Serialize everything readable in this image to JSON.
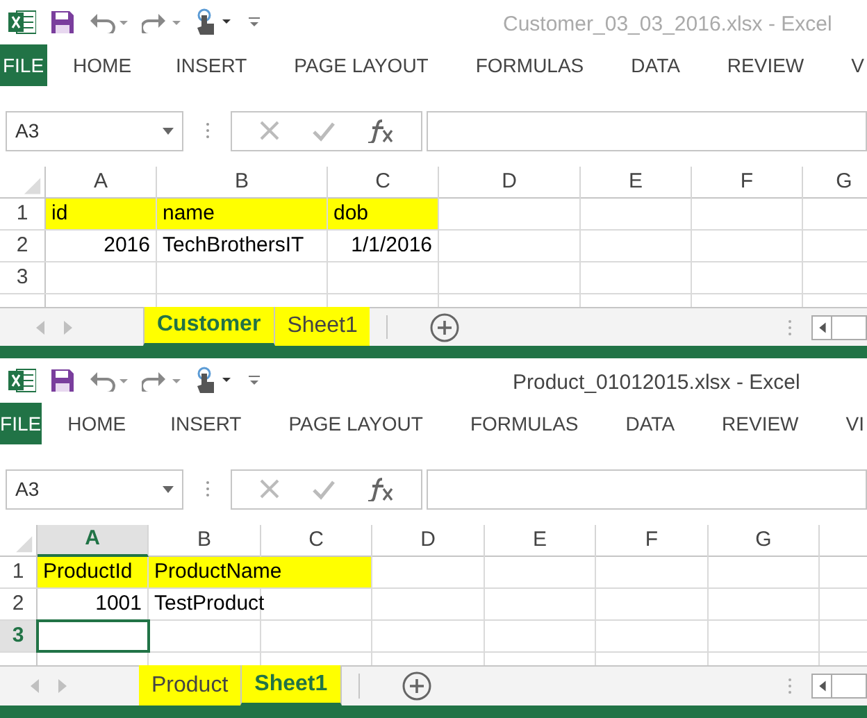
{
  "windows": [
    {
      "title": "Customer_03_03_2016.xlsx - Excel",
      "active": false,
      "ribbon_tabs": [
        "FILE",
        "HOME",
        "INSERT",
        "PAGE LAYOUT",
        "FORMULAS",
        "DATA",
        "REVIEW",
        "V"
      ],
      "name_box": "A3",
      "columns": [
        {
          "label": "A",
          "selected": false
        },
        {
          "label": "B",
          "selected": false
        },
        {
          "label": "C",
          "selected": false
        },
        {
          "label": "D",
          "selected": false
        },
        {
          "label": "E",
          "selected": false
        },
        {
          "label": "F",
          "selected": false
        },
        {
          "label": "G",
          "selected": false
        }
      ],
      "rows": [
        {
          "number": "1",
          "selected": false,
          "cells": [
            {
              "text": "id",
              "kind": "text",
              "highlighted": true,
              "selected": false
            },
            {
              "text": "name",
              "kind": "text",
              "highlighted": true,
              "selected": false
            },
            {
              "text": "dob",
              "kind": "text",
              "highlighted": true,
              "selected": false
            }
          ]
        },
        {
          "number": "2",
          "selected": false,
          "cells": [
            {
              "text": "2016",
              "kind": "number",
              "highlighted": false,
              "selected": false
            },
            {
              "text": "TechBrothersIT",
              "kind": "text",
              "highlighted": false,
              "selected": false
            },
            {
              "text": "1/1/2016",
              "kind": "number",
              "highlighted": false,
              "selected": false
            }
          ]
        },
        {
          "number": "3",
          "selected": false,
          "cells": []
        }
      ],
      "sheet_tabs": [
        {
          "label": "Customer",
          "selected": true,
          "highlighted": true
        },
        {
          "label": "Sheet1",
          "selected": false,
          "highlighted": true
        }
      ]
    },
    {
      "title": "Product_01012015.xlsx - Excel",
      "active": true,
      "ribbon_tabs": [
        "FILE",
        "HOME",
        "INSERT",
        "PAGE LAYOUT",
        "FORMULAS",
        "DATA",
        "REVIEW",
        "VI"
      ],
      "name_box": "A3",
      "columns": [
        {
          "label": "A",
          "selected": true
        },
        {
          "label": "B",
          "selected": false
        },
        {
          "label": "C",
          "selected": false
        },
        {
          "label": "D",
          "selected": false
        },
        {
          "label": "E",
          "selected": false
        },
        {
          "label": "F",
          "selected": false
        },
        {
          "label": "G",
          "selected": false
        }
      ],
      "rows": [
        {
          "number": "1",
          "selected": false,
          "cells": [
            {
              "text": "ProductId",
              "kind": "text",
              "highlighted": true,
              "selected": false
            },
            {
              "text": "ProductName",
              "kind": "text",
              "highlighted": true,
              "selected": false
            }
          ]
        },
        {
          "number": "2",
          "selected": false,
          "cells": [
            {
              "text": "1001",
              "kind": "number",
              "highlighted": false,
              "selected": false
            },
            {
              "text": "TestProduct",
              "kind": "text",
              "highlighted": false,
              "selected": false
            }
          ]
        },
        {
          "number": "3",
          "selected": true,
          "cells": [
            {
              "text": "",
              "kind": "text",
              "highlighted": false,
              "selected": true
            }
          ]
        }
      ],
      "sheet_tabs": [
        {
          "label": "Product",
          "selected": false,
          "highlighted": true
        },
        {
          "label": "Sheet1",
          "selected": true,
          "highlighted": true
        }
      ]
    }
  ]
}
